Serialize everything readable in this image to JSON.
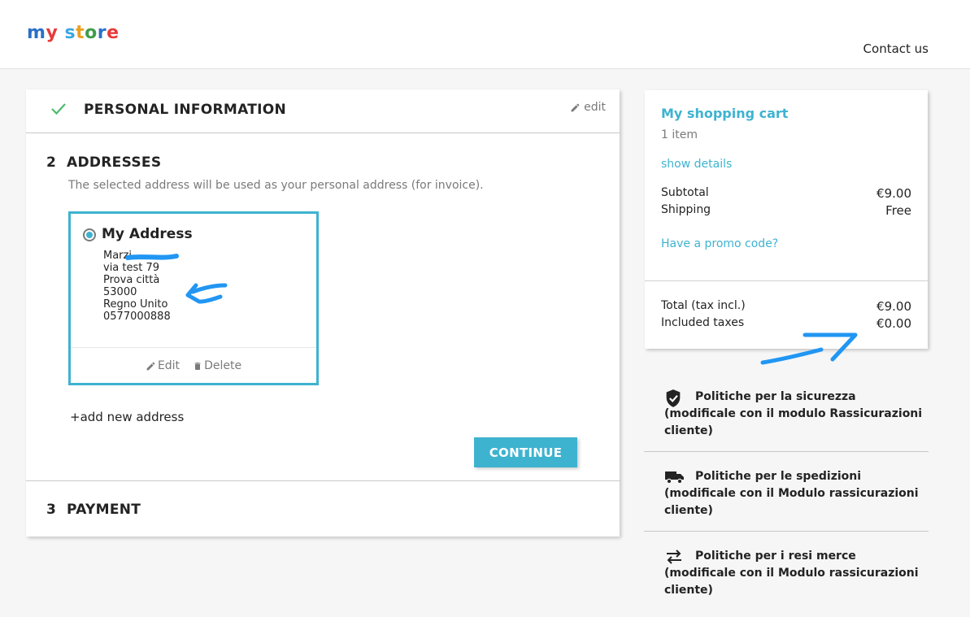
{
  "header": {
    "logo_text": "my store",
    "logo_letters": [
      {
        "ch": "m",
        "color": "#2b6fc9"
      },
      {
        "ch": "y",
        "color": "#e83b3b"
      },
      {
        "ch": " ",
        "color": "#000000"
      },
      {
        "ch": "s",
        "color": "#3aa7e0"
      },
      {
        "ch": "t",
        "color": "#e9a021"
      },
      {
        "ch": "o",
        "color": "#3f9c4a"
      },
      {
        "ch": "r",
        "color": "#2b6fc9"
      },
      {
        "ch": "e",
        "color": "#e83b3b"
      }
    ],
    "contact": "Contact us"
  },
  "steps": {
    "personal": {
      "title": "PERSONAL INFORMATION",
      "edit": "edit"
    },
    "addresses": {
      "number": "2",
      "title": "ADDRESSES",
      "description": "The selected address will be used as your personal address (for invoice).",
      "address": {
        "name": "My Address",
        "lines": [
          "Marzi",
          "via test 79",
          "Prova città",
          "53000",
          "Regno Unito",
          "0577000888"
        ],
        "edit": "Edit",
        "delete": "Delete",
        "selected": true
      },
      "add_new": "add new address",
      "continue": "CONTINUE"
    },
    "payment": {
      "number": "3",
      "title": "PAYMENT"
    }
  },
  "cart": {
    "title": "My shopping cart",
    "count": "1 item",
    "show_details": "show details",
    "subtotal_label": "Subtotal",
    "subtotal_value": "€9.00",
    "shipping_label": "Shipping",
    "shipping_value": "Free",
    "promo": "Have a promo code?",
    "total_label": "Total (tax incl.)",
    "total_value": "€9.00",
    "taxes_label": "Included taxes",
    "taxes_value": "€0.00"
  },
  "reassurance": [
    {
      "icon": "shield-check-icon",
      "title": "Politiche per la sicurezza",
      "subtitle": "(modificale con il modulo Rassicurazioni cliente)"
    },
    {
      "icon": "truck-icon",
      "title": "Politiche per le spedizioni",
      "subtitle": "(modificale con il Modulo rassicurazioni cliente)"
    },
    {
      "icon": "swap-arrows-icon",
      "title": "Politiche per i resi merce",
      "subtitle": "(modificale con il Modulo rassicurazioni cliente)"
    }
  ],
  "colors": {
    "accent": "#3eb3d0",
    "annotation": "#2196f3",
    "check": "#4cbb6c"
  }
}
